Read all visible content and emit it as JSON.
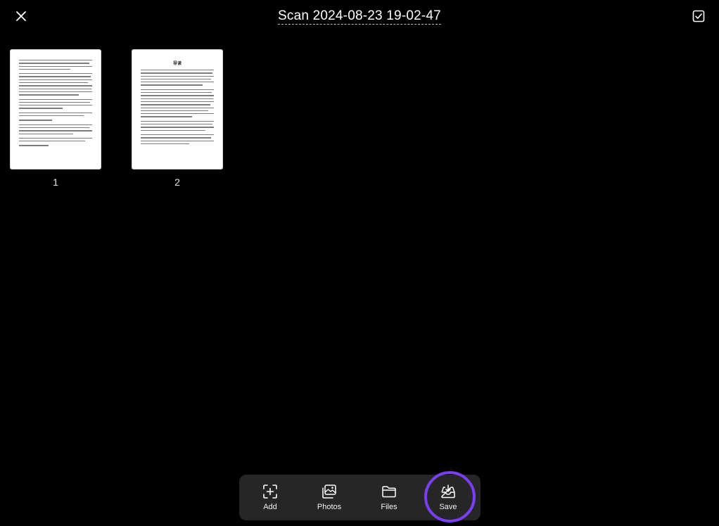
{
  "header": {
    "title": "Scan 2024-08-23 19-02-47",
    "close_icon": "close-icon",
    "select_icon": "checkbox-icon"
  },
  "pages": [
    {
      "number": "1"
    },
    {
      "number": "2",
      "heading": "导读"
    }
  ],
  "toolbar": {
    "add_label": "Add",
    "photos_label": "Photos",
    "files_label": "Files",
    "save_label": "Save"
  },
  "colors": {
    "background": "#000000",
    "toolbar_bg": "#262628",
    "highlight": "#7a3ff0"
  }
}
